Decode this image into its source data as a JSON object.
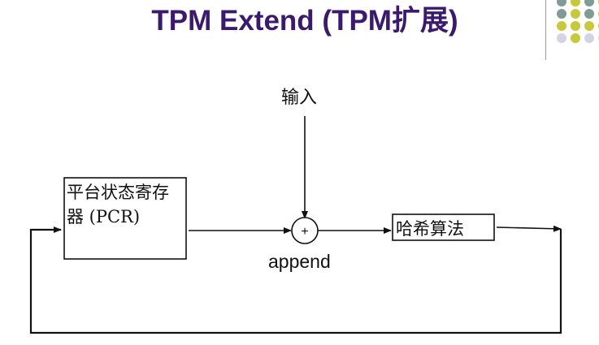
{
  "slide": {
    "title": "TPM Extend (TPM扩展)"
  },
  "decoration": {
    "dot_colors": {
      "teal": "#7f9a97",
      "olive": "#c8c83c",
      "lavender": "#d3d3e6"
    }
  },
  "diagram": {
    "input_label": "输入",
    "pcr_label": "平台状态寄存器 (PCR)",
    "append_symbol": "+",
    "append_label": "append",
    "hash_label": "哈希算法"
  },
  "colors": {
    "title": "#3b1a6b",
    "line": "#111111"
  }
}
